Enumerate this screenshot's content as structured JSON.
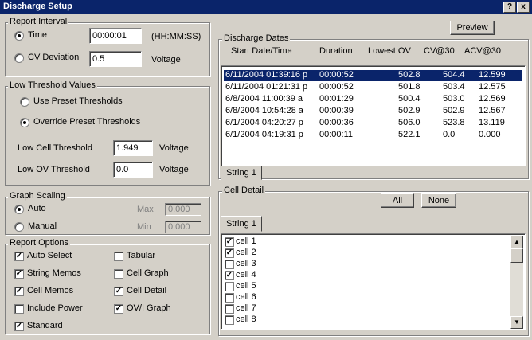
{
  "window": {
    "title": "Discharge Setup",
    "help_btn": "?",
    "close_btn": "x"
  },
  "report_interval": {
    "legend": "Report Interval",
    "time_label": "Time",
    "time_value": "00:00:01",
    "time_unit": "(HH:MM:SS)",
    "cv_label": "CV Deviation",
    "cv_value": "0.5",
    "cv_unit": "Voltage"
  },
  "low_threshold": {
    "legend": "Low Threshold Values",
    "preset_label": "Use Preset Thresholds",
    "override_label": "Override Preset Thresholds",
    "low_cell_label": "Low Cell Threshold",
    "low_cell_value": "1.949",
    "low_cell_unit": "Voltage",
    "low_ov_label": "Low OV Threshold",
    "low_ov_value": "0.0",
    "low_ov_unit": "Voltage"
  },
  "graph_scaling": {
    "legend": "Graph Scaling",
    "auto_label": "Auto",
    "manual_label": "Manual",
    "max_label": "Max",
    "max_value": "0.000",
    "min_label": "Min",
    "min_value": "0.000"
  },
  "report_options": {
    "legend": "Report Options",
    "auto_select": "Auto Select",
    "tabular": "Tabular",
    "string_memos": "String Memos",
    "cell_graph": "Cell Graph",
    "cell_memos": "Cell Memos",
    "cell_detail": "Cell Detail",
    "include_power": "Include Power",
    "ovi_graph": "OV/I Graph",
    "standard": "Standard"
  },
  "preview_btn": "Preview",
  "discharge_dates": {
    "legend": "Discharge Dates",
    "columns": [
      "Start Date/Time",
      "Duration",
      "Lowest OV",
      "CV@30",
      "ACV@30"
    ],
    "rows": [
      [
        "6/11/2004 01:39:16 p",
        "00:00:52",
        "502.8",
        "504.4",
        "12.599"
      ],
      [
        "6/11/2004 01:21:31 p",
        "00:00:52",
        "501.8",
        "503.4",
        "12.575"
      ],
      [
        "6/8/2004 11:00:39 a",
        "00:01:29",
        "500.4",
        "503.0",
        "12.569"
      ],
      [
        "6/8/2004 10:54:28 a",
        "00:00:39",
        "502.9",
        "502.9",
        "12.567"
      ],
      [
        "6/1/2004 04:20:27 p",
        "00:00:36",
        "506.0",
        "523.8",
        "13.119"
      ],
      [
        "6/1/2004 04:19:31 p",
        "00:00:11",
        "522.1",
        "0.0",
        "0.000"
      ]
    ],
    "tab": "String 1"
  },
  "cell_detail": {
    "legend": "Cell Detail",
    "all_btn": "All",
    "none_btn": "None",
    "tab": "String 1",
    "check_mark": "✓",
    "cells": [
      {
        "name": "cell 1",
        "checked": true
      },
      {
        "name": "cell 2",
        "checked": true
      },
      {
        "name": "cell 3",
        "checked": false
      },
      {
        "name": "cell 4",
        "checked": true
      },
      {
        "name": "cell 5",
        "checked": false
      },
      {
        "name": "cell 6",
        "checked": false
      },
      {
        "name": "cell 7",
        "checked": false
      },
      {
        "name": "cell 8",
        "checked": false
      }
    ]
  }
}
